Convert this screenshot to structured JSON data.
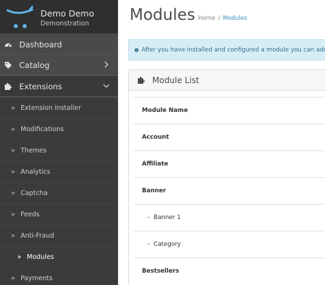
{
  "profile": {
    "name": "Demo Demo",
    "subtitle": "Demonstration"
  },
  "nav": {
    "dashboard": "Dashboard",
    "catalog": "Catalog",
    "extensions": "Extensions",
    "submenu": [
      "Extension Installer",
      "Modifications",
      "Themes",
      "Analytics",
      "Captcha",
      "Feeds",
      "Anti-Fraud",
      "Modules",
      "Payments"
    ],
    "raquo": "»"
  },
  "page": {
    "title": "Modules"
  },
  "breadcrumb": {
    "home": "Home",
    "sep": "/",
    "current": "Modules"
  },
  "alert": {
    "text": "After you have installed and configured a module you can add it"
  },
  "panel": {
    "title": "Module List"
  },
  "table": {
    "header": "Module Name",
    "rows": [
      "Account",
      "Affiliate",
      "Banner",
      "Banner 1",
      "Category",
      "Bestsellers"
    ],
    "dash": "-"
  },
  "colors": {
    "sidebar": "#4a4a4a",
    "accent": "#3b8ec2",
    "alert_bg": "#d7edf6"
  }
}
